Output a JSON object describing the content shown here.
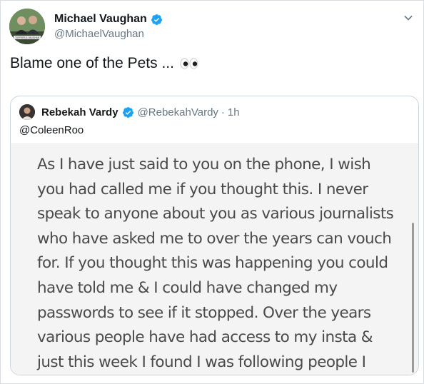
{
  "tweet": {
    "author_name": "Michael Vaughan",
    "author_handle": "@MichaelVaughan",
    "avatar_caption": "TUFFERS & VAUGHAN",
    "text": "Blame one of the Pets ...",
    "emoji": "eyes"
  },
  "quoted": {
    "author_name": "Rebekah Vardy",
    "author_handle": "@RebekahVardy",
    "separator": "·",
    "time": "1h",
    "reply_to": "@ColeenRoo",
    "note_text": "As I have just said to you on the phone, I wish you had called me if you thought this. I never speak to anyone about you as various journalists who have asked me to over the years can vouch for. If you thought this was happening you could have told me & I could have changed my passwords to see if it stopped. Over the years various people have had access to my insta & just this week I found I was following people I didn't know and have"
  },
  "colors": {
    "verified": "#1da1f2",
    "secondary_text": "#657786",
    "border": "#ccd6dd"
  },
  "icons": [
    "verified-badge-icon",
    "chevron-down-icon",
    "eyes-emoji-icon"
  ]
}
